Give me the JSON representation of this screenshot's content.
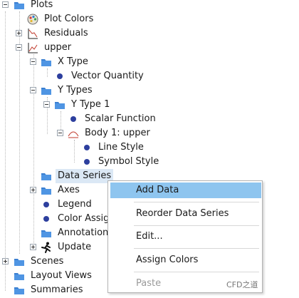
{
  "tree": {
    "plots": "Plots",
    "plot_colors": "Plot Colors",
    "residuals": "Residuals",
    "upper": "upper",
    "x_type": "X Type",
    "vector_quantity": "Vector Quantity",
    "y_types": "Y Types",
    "y_type_1": "Y Type 1",
    "scalar_function": "Scalar Function",
    "body_upper": "Body 1: upper",
    "line_style": "Line Style",
    "symbol_style": "Symbol Style",
    "data_series": "Data Series",
    "axes": "Axes",
    "legend": "Legend",
    "color_assign": "Color Assig",
    "annotations": "Annotation",
    "update": "Update",
    "scenes": "Scenes",
    "layout_views": "Layout Views",
    "summaries": "Summaries"
  },
  "context_menu": {
    "add_data": "Add Data",
    "reorder": "Reorder Data Series",
    "edit": "Edit...",
    "assign_colors": "Assign Colors",
    "paste": "Paste"
  },
  "watermark": "CFD之道",
  "colors": {
    "selection": "#dbe8f5",
    "menu_highlight": "#8ec5ef",
    "folder": "#3a7fd1",
    "dot": "#2d3f9e"
  }
}
